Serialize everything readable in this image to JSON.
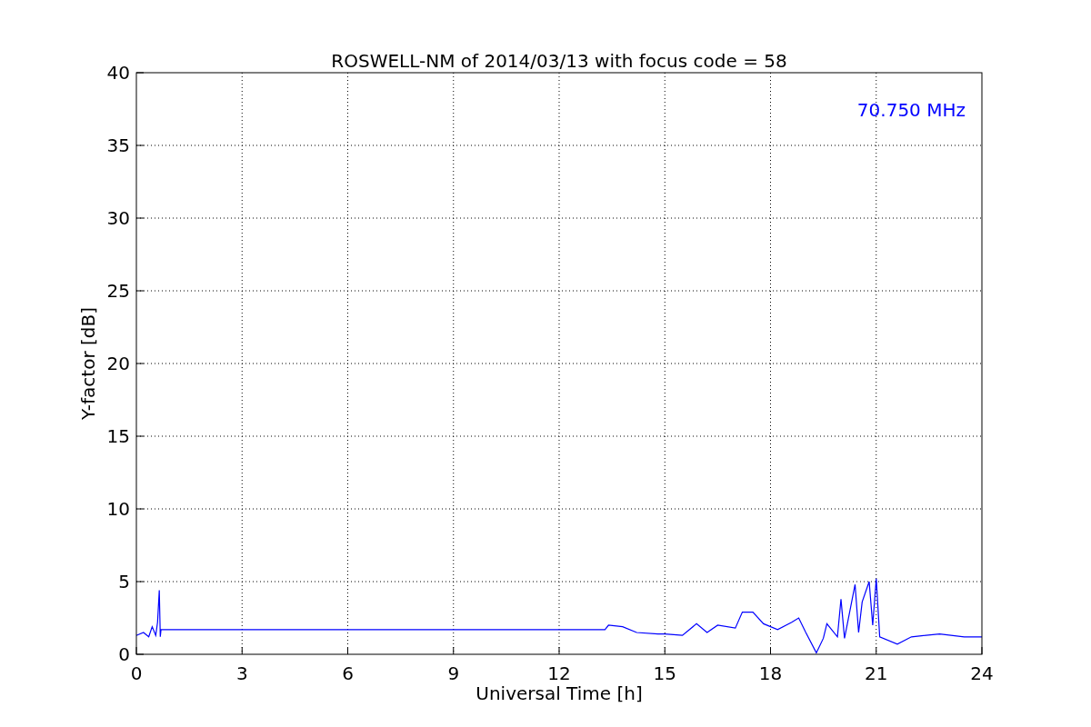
{
  "chart_data": {
    "type": "line",
    "title": "ROSWELL-NM of 2014/03/13 with focus code = 58",
    "xlabel": "Universal Time [h]",
    "ylabel": "Y-factor [dB]",
    "x": [
      0,
      0.2,
      0.35,
      0.45,
      0.55,
      0.6,
      0.65,
      0.68,
      0.7,
      13.3,
      13.4,
      13.8,
      14.2,
      14.8,
      15,
      15.5,
      15.9,
      16.2,
      16.5,
      17,
      17.2,
      17.5,
      17.8,
      18.2,
      18.6,
      18.8,
      19,
      19.3,
      19.5,
      19.6,
      19.9,
      20,
      20.1,
      20.4,
      20.5,
      20.6,
      20.8,
      20.9,
      21,
      21.1,
      21.6,
      22,
      22.8,
      23.5,
      24
    ],
    "series": [
      {
        "name": "70.750 MHz",
        "color": "#0000ff",
        "values": [
          1.3,
          1.5,
          1.2,
          1.9,
          1.3,
          2.2,
          4.4,
          1.2,
          1.7,
          1.7,
          2.0,
          1.9,
          1.5,
          1.4,
          1.4,
          1.3,
          2.1,
          1.5,
          2.0,
          1.8,
          2.9,
          2.9,
          2.1,
          1.7,
          2.2,
          2.5,
          1.5,
          0.1,
          1.1,
          2.1,
          1.2,
          3.8,
          1.1,
          4.8,
          1.5,
          3.6,
          5.0,
          2.0,
          5.2,
          1.2,
          0.7,
          1.2,
          1.4,
          1.2,
          1.2
        ]
      }
    ],
    "xlim": [
      0,
      24
    ],
    "ylim": [
      0,
      40
    ],
    "xticks": [
      0,
      3,
      6,
      9,
      12,
      15,
      18,
      21,
      24
    ],
    "yticks": [
      0,
      5,
      10,
      15,
      20,
      25,
      30,
      35,
      40
    ],
    "grid": true
  }
}
